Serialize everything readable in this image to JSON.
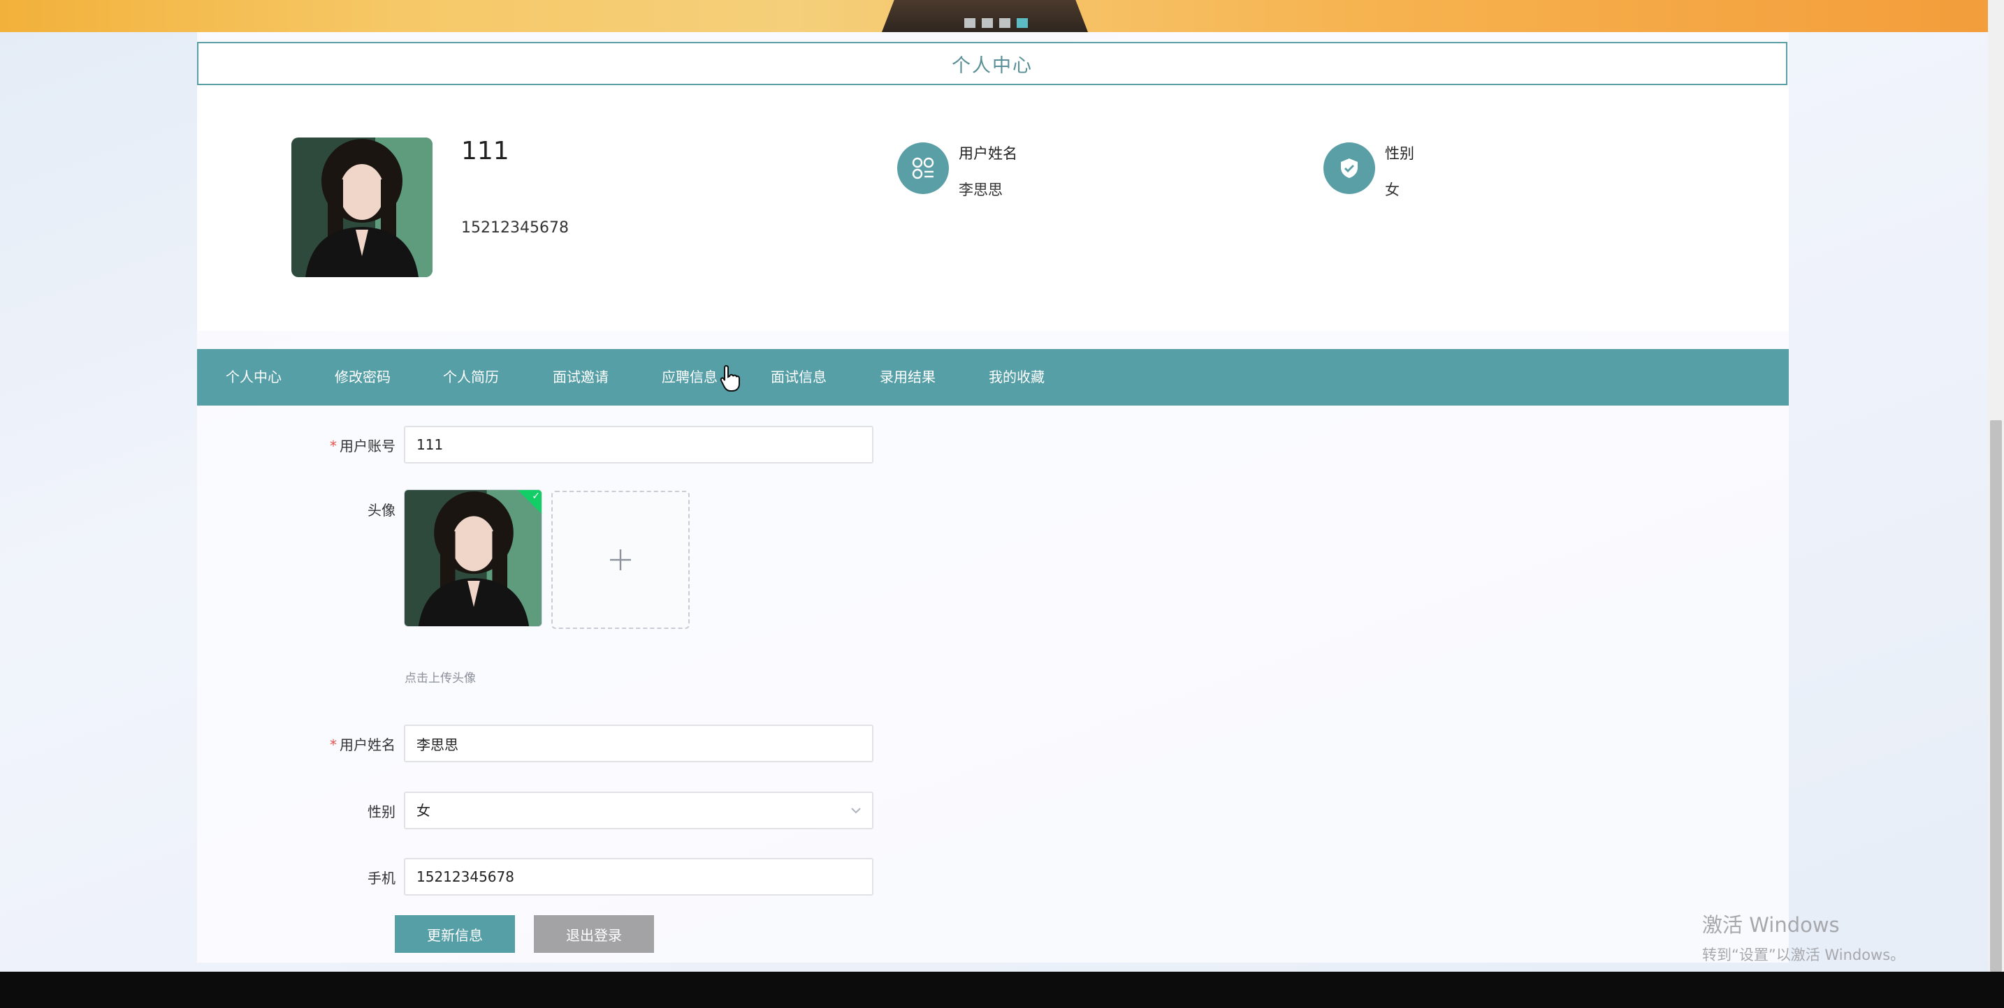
{
  "header": {
    "section_title": "个人中心"
  },
  "profile": {
    "account": "111",
    "phone": "15212345678",
    "name_label": "用户姓名",
    "name_value": "李思思",
    "gender_label": "性别",
    "gender_value": "女"
  },
  "tabs": [
    {
      "label": "个人中心"
    },
    {
      "label": "修改密码"
    },
    {
      "label": "个人简历"
    },
    {
      "label": "面试邀请"
    },
    {
      "label": "应聘信息"
    },
    {
      "label": "面试信息"
    },
    {
      "label": "录用结果"
    },
    {
      "label": "我的收藏"
    }
  ],
  "form": {
    "account_label": "用户账号",
    "account_value": "111",
    "avatar_label": "头像",
    "avatar_hint": "点击上传头像",
    "name_label": "用户姓名",
    "name_value": "李思思",
    "gender_label": "性别",
    "gender_value": "女",
    "phone_label": "手机",
    "phone_value": "15212345678",
    "required_mark": "*"
  },
  "buttons": {
    "update": "更新信息",
    "logout": "退出登录"
  },
  "watermark": {
    "line1": "激活 Windows",
    "line2": "转到“设置”以激活 Windows。"
  },
  "colors": {
    "accent": "#569fa7",
    "danger": "#e4534b",
    "success": "#13ce66"
  }
}
